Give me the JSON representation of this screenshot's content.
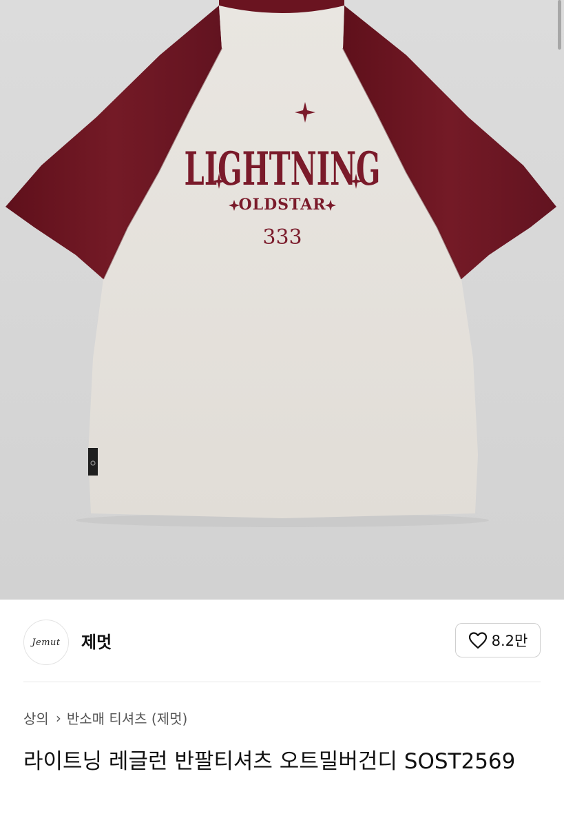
{
  "product_image": {
    "print_main": "LIGHTNING",
    "print_sub": "OLDSTAR",
    "print_number": "333",
    "colors": {
      "background": "#d8d8d8",
      "body": "#e6e3de",
      "sleeve": "#6e1621",
      "print": "#7a1a2a"
    }
  },
  "seller": {
    "avatar_logo": "Jemut",
    "name": "제멋"
  },
  "like": {
    "icon": "heart-outline-icon",
    "count": "8.2만"
  },
  "breadcrumb": {
    "category": "상의",
    "separator_icon": "chevron-right-icon",
    "subcategory": "반소매 티셔츠 (제멋)"
  },
  "product": {
    "title": "라이트닝 레글런 반팔티셔츠 오트밀버건디 SOST2569"
  }
}
